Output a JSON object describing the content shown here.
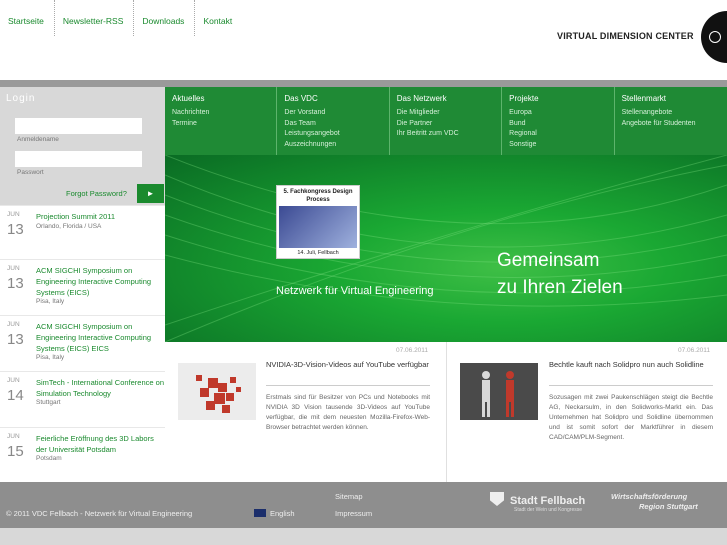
{
  "topnav": [
    "Startseite",
    "Newsletter-RSS",
    "Downloads",
    "Kontakt"
  ],
  "logo": {
    "text": "VIRTUAL DIMENSION CENTER"
  },
  "login": {
    "title": "Login",
    "username_label": "Anmeldename",
    "password_label": "Passwort",
    "forgot": "Forgot Password?",
    "go": "►"
  },
  "events": [
    {
      "month": "JUN",
      "day": "13",
      "title": "Projection Summit 2011",
      "location": "Orlando, Florida / USA"
    },
    {
      "month": "JUN",
      "day": "13",
      "title": "ACM SIGCHI Symposium on Engineering Interactive Computing Systems (EICS)",
      "location": "Pisa, Italy"
    },
    {
      "month": "JUN",
      "day": "13",
      "title": "ACM SIGCHI Symposium on Engineering Interactive Computing Systems (EICS) EICS",
      "location": "Pisa, Italy"
    },
    {
      "month": "JUN",
      "day": "14",
      "title": "SimTech - International Conference on Simulation Technology",
      "location": "Stuttgart"
    },
    {
      "month": "JUN",
      "day": "15",
      "title": "Feierliche Eröffnung des 3D Labors der Universität Potsdam",
      "location": "Potsdam"
    }
  ],
  "menu": [
    {
      "head": "Aktuelles",
      "items": [
        "Nachrichten",
        "Termine"
      ]
    },
    {
      "head": "Das VDC",
      "items": [
        "Der Vorstand",
        "Das Team",
        "Leistungsangebot",
        "Auszeichnungen"
      ]
    },
    {
      "head": "Das Netzwerk",
      "items": [
        "Die Mitglieder",
        "Die Partner",
        "Ihr Beitritt zum VDC"
      ]
    },
    {
      "head": "Projekte",
      "items": [
        "Europa",
        "Bund",
        "Regional",
        "Sonstige"
      ]
    },
    {
      "head": "Stellenmarkt",
      "items": [
        "Stellenangebote",
        "Angebote für Studenten"
      ]
    }
  ],
  "banner": {
    "poster_title": "5. Fachkongress Design Process",
    "poster_date": "14. Juli, Fellbach",
    "netzwerk": "Netzwerk für Virtual Engineering",
    "slogan1": "Gemeinsam",
    "slogan2": "zu Ihren Zielen"
  },
  "news": [
    {
      "date": "07.06.2011",
      "headline": "NVIDIA-3D-Vision-Videos auf YouTube verfügbar",
      "body": "Erstmals sind für Besitzer von PCs und Notebooks mit NVIDIA 3D Vision tausende 3D-Videos auf YouTube verfügbar, die mit dem neuesten Mozilla-Firefox-Web-Browser betrachtet werden können."
    },
    {
      "date": "07.06.2011",
      "headline": "Bechtle kauft nach Solidpro nun auch Solidline",
      "body": "Sozusagen mit zwei Paukenschlägen steigt die Bechtle AG, Neckarsulm, in den Solidworks-Markt ein. Das Unternehmen hat Solidpro und Solidline übernommen und ist somit sofort der Marktführer in diesem CAD/CAM/PLM-Segment."
    }
  ],
  "footer": {
    "copyright": "© 2011 VDC Fellbach - Netzwerk für Virtual Engineering",
    "language": "English",
    "sitemap": "Sitemap",
    "impressum": "Impressum",
    "stadt": "Stadt Fellbach",
    "stadt_sub": "Stadt der Wein und Kongresse",
    "wf1": "Wirtschaftsförderung",
    "wf2": "Region Stuttgart"
  }
}
